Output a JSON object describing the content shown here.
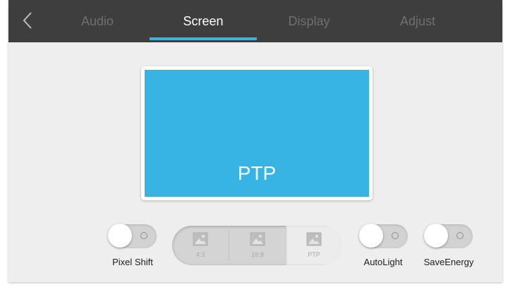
{
  "header": {
    "back_icon": "chevron-left-icon",
    "tabs": [
      {
        "label": "Audio",
        "active": false
      },
      {
        "label": "Screen",
        "active": true
      },
      {
        "label": "Display",
        "active": false
      },
      {
        "label": "Adjust",
        "active": false
      }
    ],
    "accent_color": "#38b4e4"
  },
  "preview": {
    "label": "PTP"
  },
  "toggles": {
    "pixel_shift": {
      "label": "Pixel Shift",
      "on": false
    },
    "autolight": {
      "label": "AutoLight",
      "on": false
    },
    "saveenergy": {
      "label": "SaveEnergy",
      "on": false
    }
  },
  "aspect_ratio": {
    "options": [
      {
        "label": "4:3",
        "icon": "image-icon"
      },
      {
        "label": "16:9",
        "icon": "image-icon"
      },
      {
        "label": "PTP",
        "icon": "image-icon"
      }
    ],
    "selected": "PTP"
  }
}
